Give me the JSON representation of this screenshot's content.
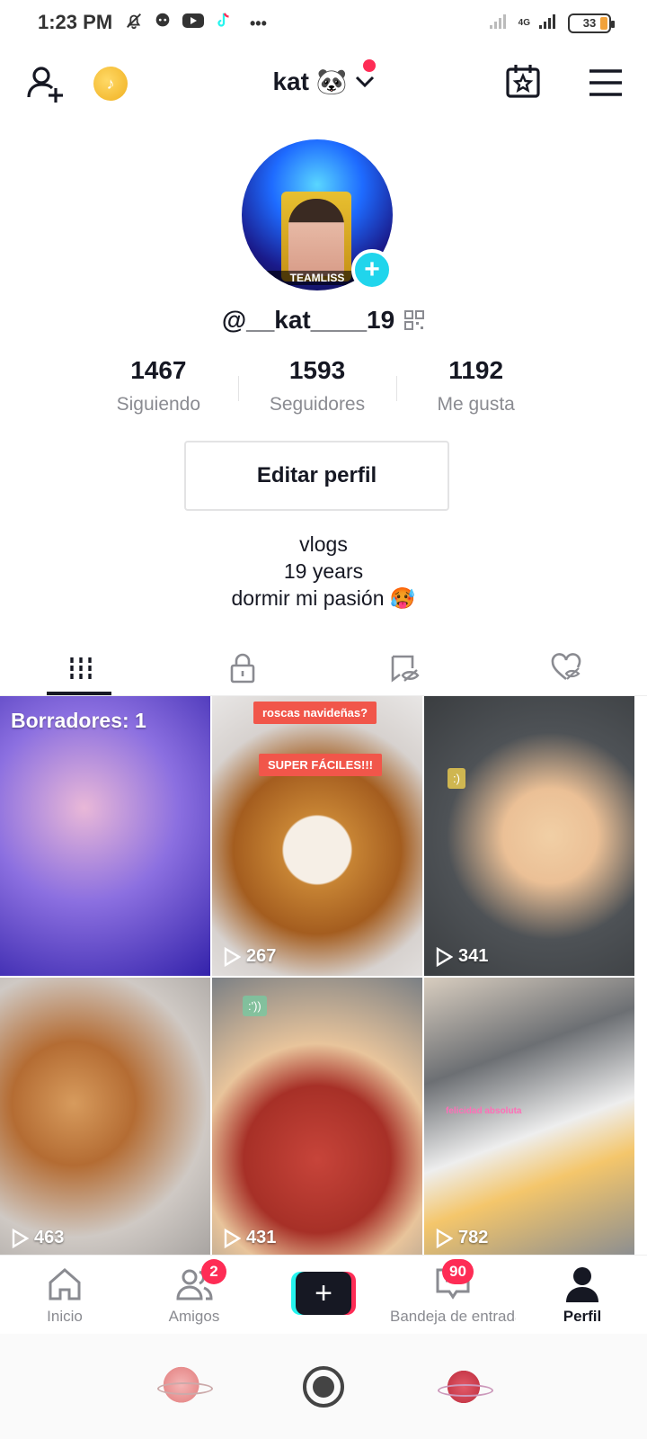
{
  "status_bar": {
    "time": "1:23 PM",
    "network": "4G",
    "battery": "33",
    "more": "•••"
  },
  "top_nav": {
    "account_name": "kat 🐼"
  },
  "profile": {
    "avatar_caption": "TEAMLISS",
    "username": "@__kat____19",
    "stats": [
      {
        "value": "1467",
        "label": "Siguiendo"
      },
      {
        "value": "1593",
        "label": "Seguidores"
      },
      {
        "value": "1192",
        "label": "Me gusta"
      }
    ],
    "edit_button": "Editar perfil",
    "bio": [
      "vlogs",
      "19 years",
      "dormir mi pasión 🥵"
    ]
  },
  "tabs": [
    "videos-grid",
    "private",
    "reposts",
    "liked"
  ],
  "grid": [
    {
      "label": "Borradores: 1",
      "views": null
    },
    {
      "views": "267",
      "tag_top": "roscas navideñas?",
      "tag_mid": "SUPER FÁCILES!!!"
    },
    {
      "views": "341",
      "tag": ":)"
    },
    {
      "views": "463"
    },
    {
      "views": "431",
      "tag": ":'))"
    },
    {
      "views": "782",
      "tag": "felicidad absoluta"
    }
  ],
  "bottom_nav": {
    "home": "Inicio",
    "friends": "Amigos",
    "friends_badge": "2",
    "inbox": "Bandeja de entrada",
    "inbox_badge": "90",
    "profile": "Perfil"
  },
  "colors": {
    "accent": "#fe2c55",
    "cyan": "#25f4ee",
    "text": "#161823",
    "muted": "#8a8b91"
  }
}
